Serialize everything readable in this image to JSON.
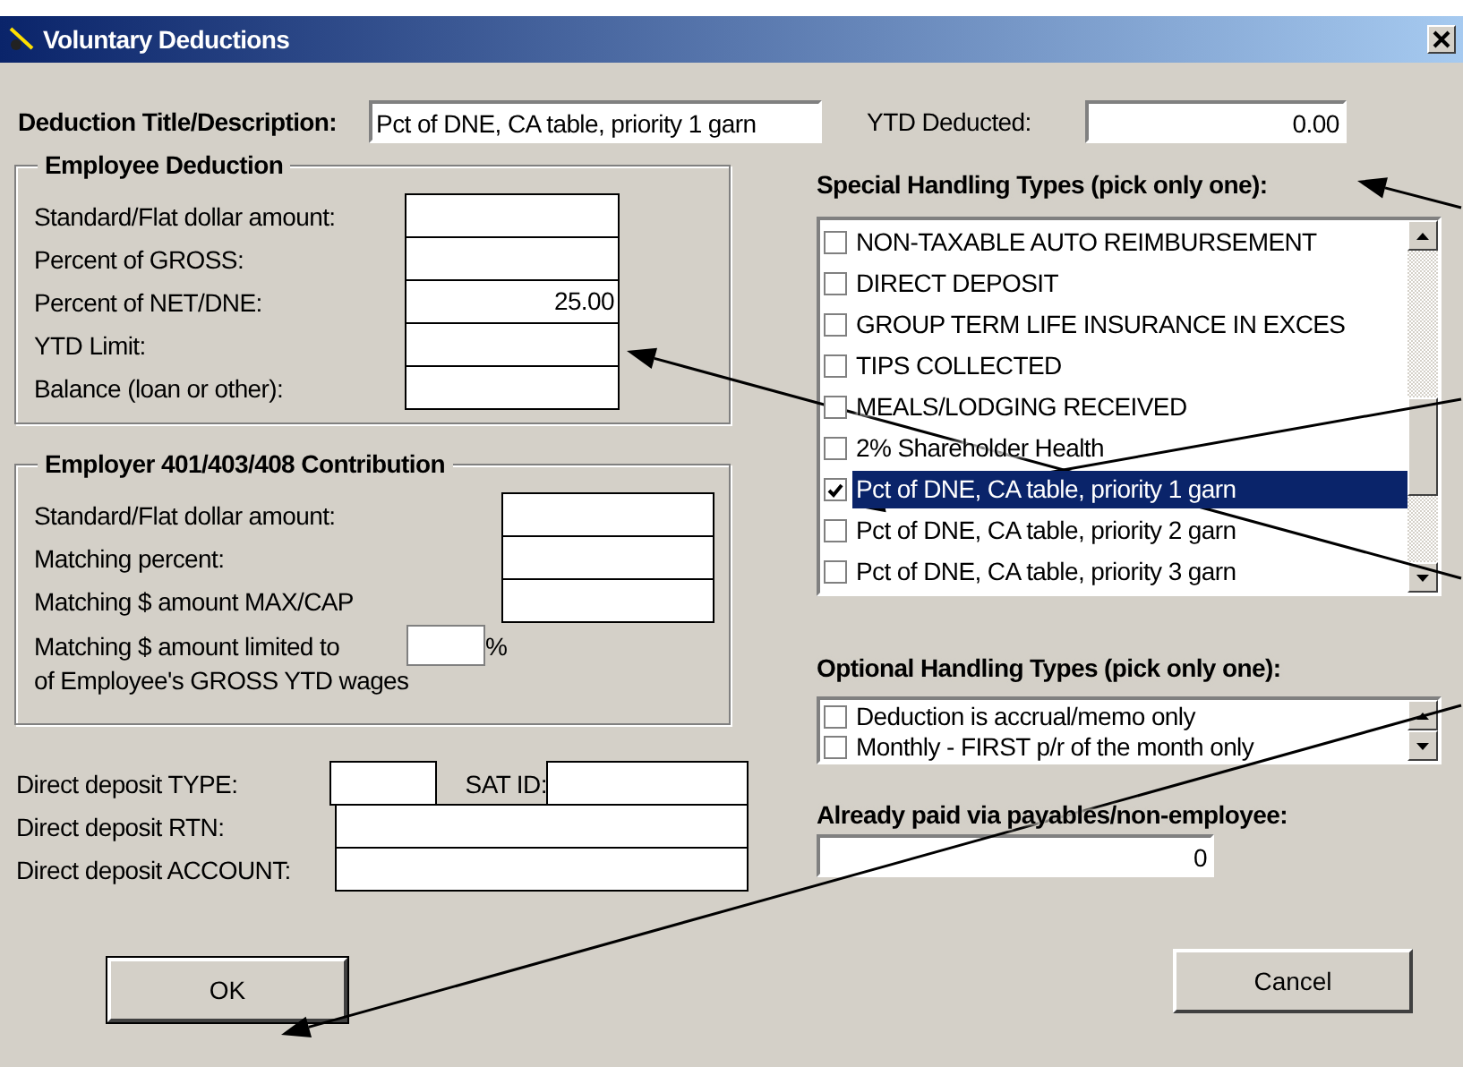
{
  "window": {
    "title": "Voluntary Deductions"
  },
  "description": {
    "label": "Deduction Title/Description:",
    "value": "Pct of DNE, CA table, priority 1 garn"
  },
  "ytd_deducted": {
    "label": "YTD Deducted:",
    "value": "0.00"
  },
  "employee_deduction": {
    "title": "Employee Deduction",
    "fields": [
      {
        "label": "Standard/Flat dollar amount:"
      },
      {
        "label": "Percent of GROSS:"
      },
      {
        "label": "Percent of NET/DNE:",
        "value": "25.00"
      },
      {
        "label": "YTD Limit:"
      },
      {
        "label": "Balance (loan or other):"
      }
    ]
  },
  "employer_contribution": {
    "title": "Employer 401/403/408 Contribution",
    "fields": [
      {
        "label": "Standard/Flat dollar amount:"
      },
      {
        "label": "Matching percent:"
      },
      {
        "label": "Matching $ amount MAX/CAP"
      }
    ],
    "limit": {
      "label": "Matching $ amount limited to",
      "suffix": "%",
      "note": "of Employee's GROSS YTD wages"
    }
  },
  "direct_deposit": {
    "type_label": "Direct deposit TYPE:",
    "sat_id_label": "SAT ID:",
    "rtn_label": "Direct deposit RTN:",
    "account_label": "Direct deposit ACCOUNT:"
  },
  "special_handling": {
    "title": "Special Handling Types (pick only one):",
    "items": [
      {
        "label": "NON-TAXABLE AUTO REIMBURSEMENT",
        "checked": false,
        "selected": false
      },
      {
        "label": "DIRECT DEPOSIT",
        "checked": false,
        "selected": false
      },
      {
        "label": "GROUP TERM LIFE INSURANCE IN EXCES",
        "checked": false,
        "selected": false
      },
      {
        "label": "TIPS COLLECTED",
        "checked": false,
        "selected": false
      },
      {
        "label": "MEALS/LODGING RECEIVED",
        "checked": false,
        "selected": false
      },
      {
        "label": "2% Shareholder Health",
        "checked": false,
        "selected": false
      },
      {
        "label": "Pct of DNE, CA table, priority 1 garn",
        "checked": true,
        "selected": true
      },
      {
        "label": "Pct of DNE, CA table, priority 2 garn",
        "checked": false,
        "selected": false
      },
      {
        "label": "Pct of DNE, CA table, priority 3 garn",
        "checked": false,
        "selected": false
      }
    ]
  },
  "optional_handling": {
    "title": "Optional Handling Types (pick only one):",
    "items": [
      {
        "label": "Deduction is accrual/memo only",
        "checked": false,
        "selected": false
      },
      {
        "label": "Monthly - FIRST p/r of the month only",
        "checked": false,
        "selected": false
      }
    ]
  },
  "already_paid": {
    "label": "Already paid via payables/non-employee:",
    "value": "0"
  },
  "buttons": [
    {
      "label": "OK",
      "default": true
    },
    {
      "label": "Cancel",
      "default": false
    }
  ]
}
